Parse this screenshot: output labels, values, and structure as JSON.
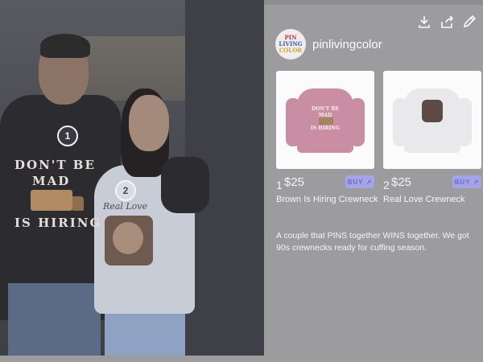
{
  "photo": {
    "print_line1": "DON'T BE",
    "print_line2": "MAD",
    "print_line3": "IS HIRING",
    "woman_print": "Real Love",
    "markers": [
      "1",
      "2"
    ]
  },
  "panel": {
    "username": "pinlivingcolor",
    "avatar_text": [
      "PIN",
      "LIVING",
      "COLOR"
    ],
    "tools": [
      "download-icon",
      "share-icon",
      "edit-icon"
    ],
    "products": [
      {
        "number": "1",
        "price": "$25",
        "buy_label": "BUY ↗",
        "name": "Brown Is Hiring Crewneck",
        "sweater_text": [
          "DON'T BE",
          "MAD",
          "",
          "IS HIRING"
        ]
      },
      {
        "number": "2",
        "price": "$25",
        "buy_label": "BUY ↗",
        "name": "Real Love Crewneck"
      }
    ],
    "description": "A couple that PINS together WINS together. We got 90s crewnecks ready for cuffing season."
  },
  "colors": {
    "overlay": "#9c9c9e",
    "buy_bg": "#a3a3e6",
    "buy_text": "#6b6bd0"
  }
}
